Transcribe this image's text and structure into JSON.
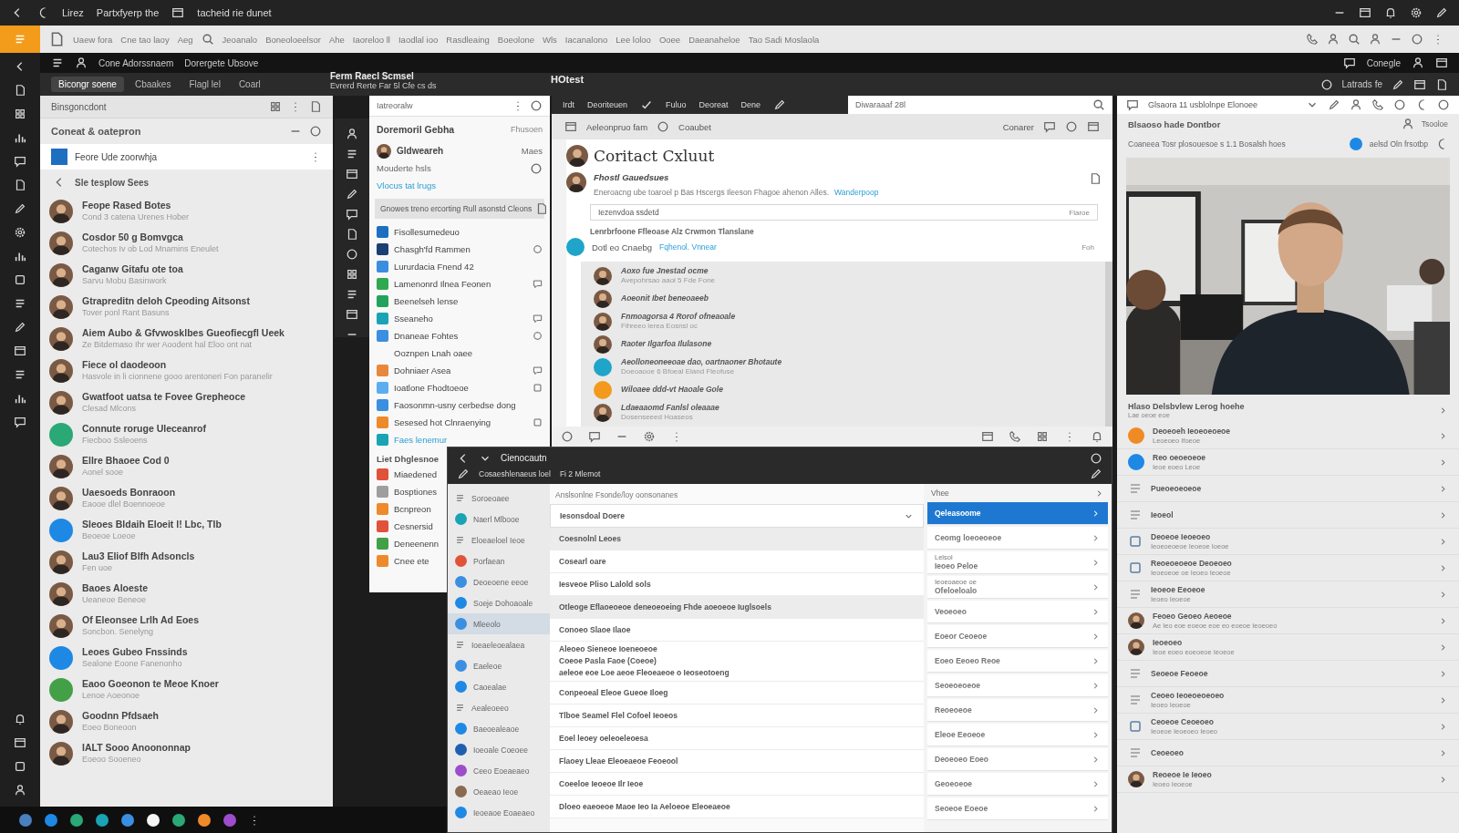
{
  "title_bar": {
    "items": [
      "Lirez",
      "Partxfyerp the",
      "tacheid rie dunet"
    ]
  },
  "toolbar": {
    "items": [
      "Uaew fora",
      "Cne tao laoy",
      "Aeg",
      "Jeoanalo",
      "Boneoloeelsor",
      "Ahe",
      "Iaoreloo ll",
      "Iaodlal ioo",
      "Rasdleaing",
      "Boeolone",
      "Wls",
      "Iacanalono",
      "Lee loloo",
      "Ooee",
      "Daeanaheloe",
      "Tao Sadi Moslaola"
    ]
  },
  "nav_bar": {
    "items": [
      "Cone Adorssnaem",
      "Dorergete Ubsove"
    ],
    "right_label": "Conegle"
  },
  "tab_bar": {
    "tabs": [
      {
        "label": "Bicongr soene",
        "selected": true
      },
      {
        "label": "Cbaakes",
        "selected": false
      },
      {
        "label": "Flagl lel",
        "selected": false
      },
      {
        "label": "Coarl",
        "selected": false
      }
    ],
    "window_title": "Ferm Raecl Scmsel",
    "window_subtitle": "Evrerd Rerte Far 5l Cfe cs ds",
    "pane_title": "HOtest",
    "right_label": "Latrads fe"
  },
  "contacts": {
    "header": "Binsgoncdont",
    "section": "Coneat & oatepron",
    "search_value": "Feore Ude zoorwhja",
    "back_label": "Sle tesplow Sees",
    "items": [
      {
        "name": "Feope Rased Botes",
        "preview": "Cond 3 catena Urenes Hober"
      },
      {
        "name": "Cosdor 50 g Bomvgca",
        "preview": "Cotechos Iv ob Lod Mnamins Eneulet"
      },
      {
        "name": "Caganw Gitafu ote toa",
        "preview": "Sarvu Mobu Basinwork"
      },
      {
        "name": "Gtrapreditn deloh Cpeoding Aitsonst",
        "preview": "Tover ponl Rant Basuns"
      },
      {
        "name": "Aiem Aubo & Gfvwosklbes Gueofiecgfl Ueek",
        "preview": "Ze Bitdemaso Ihr wer Aoodent hal Eloo ont nat"
      },
      {
        "name": "Fiece ol daodeoon",
        "preview": "Hasvole in li cionnene gooo arentoneri Fon paranelir"
      },
      {
        "name": "Gwatfoot uatsa te Fovee Grepheoce",
        "preview": "Clesad Mlcons"
      },
      {
        "name": "Connute roruge Uleceanrof",
        "preview": "Fiecboo Ssleoens",
        "kind": "badge",
        "color": "#2aa876"
      },
      {
        "name": "Ellre Bhaoee Cod 0",
        "preview": "Aonel sooe"
      },
      {
        "name": "Uaesoeds Bonraoon",
        "preview": "Eaooe dlel Boennoeoe"
      },
      {
        "name": "Sleoes Bldaih Eloeit l! Lbc, Tlb",
        "preview": "Beoeoe Loeoe",
        "kind": "badge",
        "color": "#1e88e5"
      },
      {
        "name": "Lau3 Eliof Blfh Adsoncls",
        "preview": "Fen uoe"
      },
      {
        "name": "Baoes Aloeste",
        "preview": "Ueaneoe Beneoe"
      },
      {
        "name": "Of Eleonsee Lrlh Ad Eoes",
        "preview": "Soncbon. Senelyng"
      },
      {
        "name": "Leoes Gubeo Fnssinds",
        "preview": "Sealone Eoone Fanenonho",
        "kind": "badge",
        "color": "#1e88e5"
      },
      {
        "name": "Eaoo Goeonon te Meoe Knoer",
        "preview": "Lenoe Aoeonoe",
        "kind": "badge",
        "color": "#43a047"
      },
      {
        "name": "Goodnn Pfdsaeh",
        "preview": "Eoeo Boneoon"
      },
      {
        "name": "IALT Sooo Anoononnap",
        "preview": "Eoeoo Sooeneo"
      }
    ]
  },
  "notes": {
    "header_field": "Iatreoralw",
    "title": "Doremoril Gebha",
    "action": "Fhusoen",
    "owner": "Gldweareh",
    "owner_meta": "Maes",
    "subtitle": "Mouderte hsls",
    "link": "Vlocus tat lrugs",
    "banner": "Gnowes treno ercorting Rull asonstd Cleons",
    "items": [
      {
        "label": "Fisollesumedeuo",
        "color": "#1e6fc0"
      },
      {
        "label": "Chasgh'fd Rammen",
        "color": "#1b3f73",
        "kind": "ring"
      },
      {
        "label": "Lururdacia Fnend 42",
        "color": "#3b8de0"
      },
      {
        "label": "Lamenonrd Ilnea Feonen",
        "color": "#2fa84f",
        "kind": "dot"
      },
      {
        "label": "Beenelseh lense",
        "color": "#21a35b"
      },
      {
        "label": "Sseaneho",
        "color": "#1aa3b5",
        "kind": "dot"
      },
      {
        "label": "Dnaneae Fohtes",
        "color": "#3a8fe0",
        "kind": "ring"
      },
      {
        "label": "Ooznpen Lnah oaee"
      },
      {
        "label": "Dohniaer Asea",
        "color": "#e8883a",
        "kind": "dot"
      },
      {
        "label": "Ioatlone Fhodtoeoe",
        "color": "#5aaef0",
        "kind": "box"
      },
      {
        "label": "Faosonmn-usny cerbedse dong",
        "color": "#3a8fe0"
      },
      {
        "label": "Sesesed hot Clnraenying",
        "color": "#ef8a2a",
        "kind": "box"
      },
      {
        "label": "Faes lenemur",
        "color": "#1aa3b5",
        "link": true
      }
    ],
    "section": "Liet Dhglesnoe",
    "section_items": [
      {
        "label": "Miaedened",
        "color": "#e0523a"
      },
      {
        "label": "Bosptiones",
        "color": "#9e9e9e"
      },
      {
        "label": "Bcnpreon",
        "color": "#ef8a2a"
      },
      {
        "label": "Cesnersid",
        "color": "#e0523a"
      },
      {
        "label": "Deneenenn",
        "color": "#43a047"
      },
      {
        "label": "Cnee ete",
        "color": "#ef8a2a"
      }
    ]
  },
  "chat": {
    "toolbar": [
      "Irdt",
      "Deoriteuen",
      "Fuluo",
      "Deoreat",
      "Dene"
    ],
    "search_value": "Diwaraaaf 28l",
    "subbar": [
      "Aeleonpruo fam",
      "Coaubet"
    ],
    "subbar_right": "Conarer",
    "title": "Coritact Cxluut",
    "post": {
      "author": "Fhostl Gauedsues",
      "text": "Eneroacng ube toaroel p Bas Hscergs Ileeson Fhagoe ahenon Alles.",
      "link": "Wanderpoop"
    },
    "input_value": "Iezenvdoa ssdetd",
    "input_action": "Flaroe",
    "note": "Lenrbrfoone Ffleoase Alz Crwmon Tlanslane",
    "reply": {
      "text": "Dotl eo Cnaebg",
      "link": "Fqhenol. Vnnear",
      "meta": "Foh"
    },
    "thread": [
      {
        "name": "Aoxo fue Jnestad ocme",
        "sub": "Avepohrsao aaol 5 Fde Fone"
      },
      {
        "name": "Aoeonit Ibet beneoaeeb"
      },
      {
        "name": "Fnmoagorsa 4 Rorof ofneaoale",
        "sub": "Fihreeo lerea Eosnsl oc"
      },
      {
        "name": "Raoter Ilgarfoa Ilulasone"
      },
      {
        "name": "Aeolloneoneeoae dao, oartnaoner Bhotaute",
        "sub": "Doeoaooe 6 Bfoeal Eland Fleofuse",
        "kind": "badge",
        "color": "#1ea5c9"
      },
      {
        "name": "Wiloaee ddd-vt Haoale Gole",
        "kind": "badge",
        "color": "#f39a1e"
      },
      {
        "name": "Ldaeaaomd Fanlsl oleaaae",
        "sub": "Dosenseeed Hoaseos"
      }
    ]
  },
  "settings": {
    "title": "Cienocautn",
    "subtitle": "Cosaeshlenaeus loel",
    "subtitle_meta": "Fi 2 Mlemot",
    "nav": [
      {
        "label": "Soroeoaee",
        "selected": false
      },
      {
        "label": "Naerl Mlbooe",
        "selected": false,
        "color": "#1aa3b5"
      },
      {
        "label": "Eloeaeloel Ieoe",
        "selected": false
      },
      {
        "label": "Porfaean",
        "selected": false,
        "color": "#e0523a"
      },
      {
        "label": "Deoeoene eeoe",
        "selected": false,
        "color": "#3a8fe0"
      },
      {
        "label": "Soeje Dohoaoale",
        "selected": false,
        "color": "#1e88e5"
      },
      {
        "label": "Mleeolo",
        "selected": true,
        "color": "#3a8fe0"
      },
      {
        "label": "Ioeaeleoealaea",
        "selected": false
      },
      {
        "label": "Eaeleoe",
        "selected": false,
        "color": "#3a8fe0"
      },
      {
        "label": "Caoealae",
        "selected": false,
        "color": "#1e88e5"
      },
      {
        "label": "Aealeoeeo",
        "selected": false
      },
      {
        "label": "Baeoealeaoe",
        "selected": false,
        "color": "#1e88e5"
      },
      {
        "label": "Ioeoale Coeoee",
        "selected": false,
        "color": "#1e5fb0"
      },
      {
        "label": "Ceeo Eoeaeaeo",
        "selected": false,
        "color": "#9c4dcc"
      },
      {
        "label": "Oeaeao Ieoe",
        "selected": false,
        "color": "#8a6a50"
      },
      {
        "label": "Ieoeaoe Eoaeaeo",
        "selected": false,
        "color": "#1e88e5"
      }
    ],
    "list_header": "Anslsonlne Fsonde/loy oonsonanes",
    "rows": [
      {
        "kind": "select",
        "lines": [
          "Iesonsdoal Doere"
        ]
      },
      {
        "kind": "shaded",
        "lines": [
          "Coesnolnl Leoes"
        ]
      },
      {
        "kind": "plain",
        "lines": [
          "Cosearl oare"
        ]
      },
      {
        "kind": "plain",
        "lines": [
          "Iesveoe Pliso Lalold sols"
        ]
      },
      {
        "kind": "shaded",
        "lines": [
          "Otleoge Eflaoeoeoe deneoeoeing Fhde aoeoeoe Iuglsoels"
        ]
      },
      {
        "kind": "plain",
        "lines": [
          "Conoeo Slaoe Ilaoe"
        ]
      },
      {
        "kind": "plain",
        "lines": [
          "Aleoeo Sieneoe Ioeneoeoe",
          "Coeoe Pasla Faoe (Coeoe)",
          "aeleoe eoe Loe aeoe Fleoeaeoe o Ieoseotoeng"
        ]
      },
      {
        "kind": "plain",
        "lines": [
          "Conpeoeal Eleoe Gueoe Iloeg"
        ]
      },
      {
        "kind": "plain",
        "lines": [
          "Tlboe Seamel Flel Cofoel Ieoeos"
        ]
      },
      {
        "kind": "plain",
        "lines": [
          "Eoel leoey oeleoeleoesa"
        ]
      },
      {
        "kind": "plain",
        "lines": [
          "Flaoey Lleae Eleoeaeoe Feoeool"
        ]
      },
      {
        "kind": "plain",
        "lines": [
          "Coeeloe Ieoeoe Ilr Ieoe"
        ]
      },
      {
        "kind": "plain",
        "lines": [
          "Dloeo eaeoeoe Maoe Ieo Ia Aeloeoe Eleoeaeoe"
        ]
      }
    ],
    "side_header": "Vhee",
    "side": [
      {
        "label": "Qeleasoome",
        "selected": true
      },
      {
        "label": "Ceomg loeoeoeoe",
        "selected": false
      },
      {
        "label": "Ieoeo Peloe",
        "sub": "Lelsol",
        "selected": false
      },
      {
        "label": "Ofeloeloalo",
        "sub": "Ieoeoaeoe oe",
        "selected": false
      },
      {
        "label": "Veoeoeo",
        "selected": false
      },
      {
        "label": "Eoeor Ceoeoe",
        "selected": false
      },
      {
        "label": "Eoeo Eeoeo Reoe",
        "selected": false
      },
      {
        "label": "Seoeoeoeoe",
        "selected": false
      },
      {
        "label": "Reoeoeoe",
        "selected": false
      },
      {
        "label": "Eleoe Eeoeoe",
        "selected": false
      },
      {
        "label": "Deoeoeo Eoeo",
        "selected": false
      },
      {
        "label": "Geoeoeoe",
        "selected": false
      },
      {
        "label": "Seoeoe Eoeoe",
        "selected": false
      }
    ]
  },
  "profile": {
    "toolbar_title": "Glsaora 11 usblolnpe Elonoee",
    "title": "Blsaoso hade Dontbor",
    "title_meta": "Tsooloe",
    "subtitle": "Coaneea Tosr plosouesoe s 1.1 Bosalsh hoes",
    "status": "aelsd Oln frsotbp",
    "list_title": "Hlaso Delsbvlew Lerog hoehe",
    "list_subtitle": "Lae oeoe eoe",
    "items": [
      {
        "name": "Deoeoeh Ieoeoeoeoe",
        "sub": "Leoeoeo Ifoeoe",
        "kind": "badge",
        "color": "#f08a24"
      },
      {
        "name": "Reo oeoeoeoe",
        "sub": "Ieoe eoeo Leoe",
        "kind": "badge",
        "color": "#1e88e5"
      },
      {
        "name": "Pueoeoeoeoe",
        "kind": "plain"
      },
      {
        "name": "Ieoeol",
        "kind": "plain"
      },
      {
        "name": "Deoeoe Ieoeoeo",
        "sub": "Ieoeoeoeoe Ieoeoe Ioeoe",
        "kind": "box"
      },
      {
        "name": "Reoeoeoeoe Deoeoeo",
        "sub": "Ieoeoeoe oe Ieoeo Ieoeoe",
        "kind": "box"
      },
      {
        "name": "Ieoeoe Eeoeoe",
        "sub": "Ieoeo Ieoeoe",
        "kind": "plain"
      },
      {
        "name": "Feoeo Geoeo Aeoeoe",
        "sub": "Ae Ieo eoe eoeoe eoe eo eoeoe Ieoeoeo"
      },
      {
        "name": "Ieoeoeo",
        "sub": "Ieoe eoeo eoeoeoe Ieoeoe"
      },
      {
        "name": "Seoeoe Feoeoe",
        "kind": "plain"
      },
      {
        "name": "Ceoeo Ieoeoeoeoeo",
        "sub": "Ieoeo Ieoeoe",
        "kind": "plain"
      },
      {
        "name": "Ceoeoe Ceoeoeo",
        "sub": "Ieoeoe Ieoeoeo Ieoeo",
        "kind": "box"
      },
      {
        "name": "Ceoeoeo",
        "kind": "plain"
      },
      {
        "name": "Reoeoe Ie Ieoeo",
        "sub": "Ieoeo Ieoeoe"
      }
    ]
  }
}
